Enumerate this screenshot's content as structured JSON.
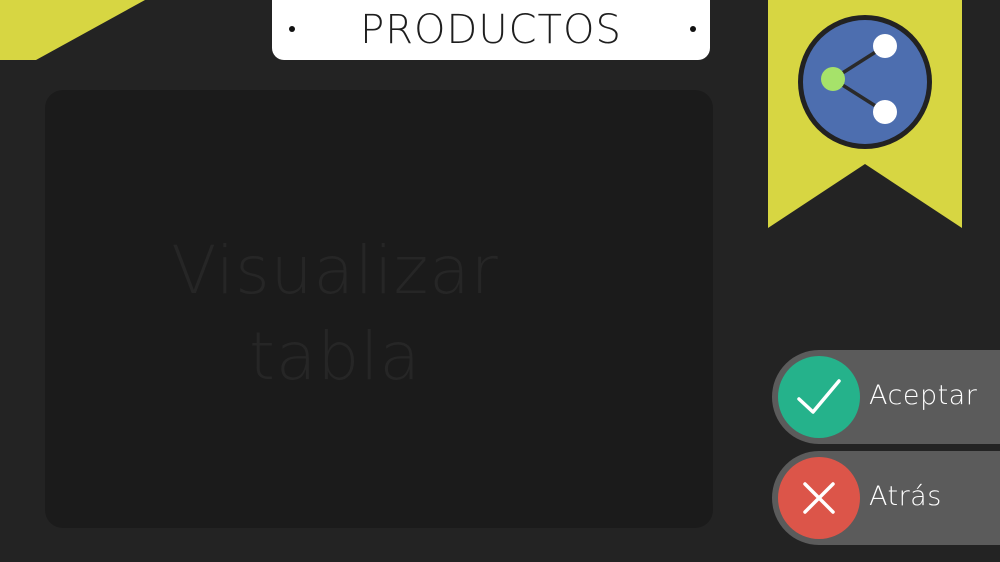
{
  "header": {
    "title": "PRODUCTOS"
  },
  "table_panel": {
    "placeholder": "Visualizar\ntabla"
  },
  "share": {
    "icon": "share-icon"
  },
  "actions": {
    "accept_label": "Aceptar",
    "back_label": "Atrás",
    "accept_icon": "checkmark-icon",
    "back_icon": "close-icon"
  },
  "colors": {
    "background": "#232323",
    "panel": "#1b1b1b",
    "accent_yellow": "#d7d642",
    "share_blue": "#4d6eaf",
    "share_green": "#a6e26a",
    "accept_green": "#25b28b",
    "back_red": "#dc5549",
    "button_gray": "#5b5b5b"
  }
}
